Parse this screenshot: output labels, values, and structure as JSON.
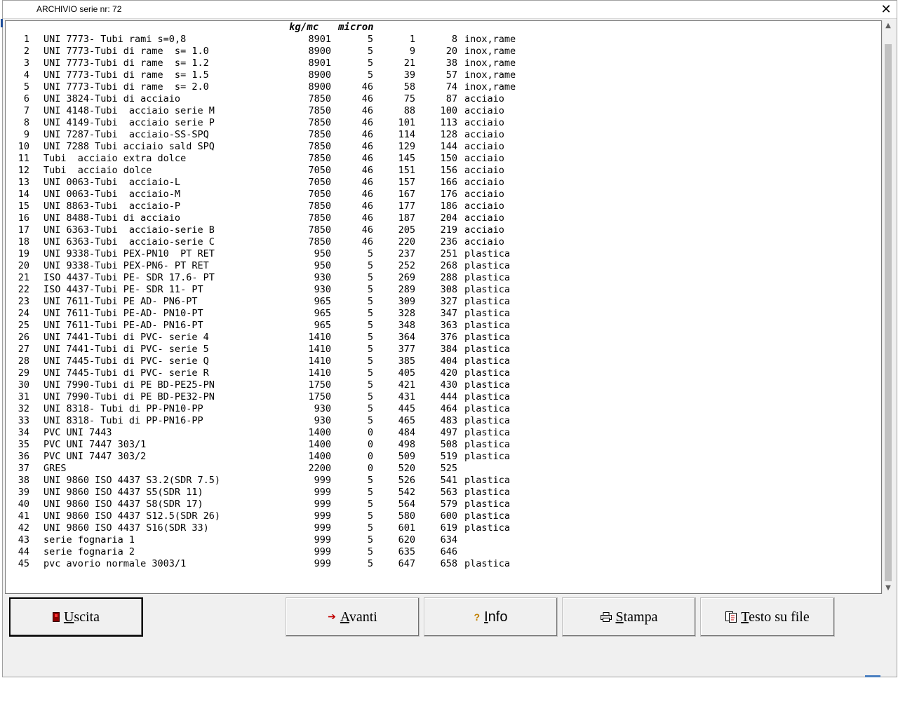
{
  "window": {
    "title": "ARCHIVIO serie nr: 72",
    "close_label": "✕"
  },
  "header": {
    "density_unit": "kg/mc",
    "thickness_unit": "micron"
  },
  "rows": [
    {
      "n": "1",
      "name": "UNI 7773- Tubi rami s=0,8",
      "dens": "8901",
      "mic": "5",
      "from": "1",
      "to": "8",
      "mat": "inox,rame"
    },
    {
      "n": "2",
      "name": "UNI 7773-Tubi di rame  s= 1.0",
      "dens": "8900",
      "mic": "5",
      "from": "9",
      "to": "20",
      "mat": "inox,rame"
    },
    {
      "n": "3",
      "name": "UNI 7773-Tubi di rame  s= 1.2",
      "dens": "8901",
      "mic": "5",
      "from": "21",
      "to": "38",
      "mat": "inox,rame"
    },
    {
      "n": "4",
      "name": "UNI 7773-Tubi di rame  s= 1.5",
      "dens": "8900",
      "mic": "5",
      "from": "39",
      "to": "57",
      "mat": "inox,rame"
    },
    {
      "n": "5",
      "name": "UNI 7773-Tubi di rame  s= 2.0",
      "dens": "8900",
      "mic": "46",
      "from": "58",
      "to": "74",
      "mat": "inox,rame"
    },
    {
      "n": "6",
      "name": "UNI 3824-Tubi di acciaio",
      "dens": "7850",
      "mic": "46",
      "from": "75",
      "to": "87",
      "mat": "acciaio"
    },
    {
      "n": "7",
      "name": "UNI 4148-Tubi  acciaio serie M",
      "dens": "7850",
      "mic": "46",
      "from": "88",
      "to": "100",
      "mat": "acciaio"
    },
    {
      "n": "8",
      "name": "UNI 4149-Tubi  acciaio serie P",
      "dens": "7850",
      "mic": "46",
      "from": "101",
      "to": "113",
      "mat": "acciaio"
    },
    {
      "n": "9",
      "name": "UNI 7287-Tubi  acciaio-SS-SPQ",
      "dens": "7850",
      "mic": "46",
      "from": "114",
      "to": "128",
      "mat": "acciaio"
    },
    {
      "n": "10",
      "name": "UNI 7288 Tubi acciaio sald SPQ",
      "dens": "7850",
      "mic": "46",
      "from": "129",
      "to": "144",
      "mat": "acciaio"
    },
    {
      "n": "11",
      "name": "Tubi  acciaio extra dolce",
      "dens": "7850",
      "mic": "46",
      "from": "145",
      "to": "150",
      "mat": "acciaio"
    },
    {
      "n": "12",
      "name": "Tubi  acciaio dolce",
      "dens": "7050",
      "mic": "46",
      "from": "151",
      "to": "156",
      "mat": "acciaio"
    },
    {
      "n": "13",
      "name": "UNI 0063-Tubi  acciaio-L",
      "dens": "7050",
      "mic": "46",
      "from": "157",
      "to": "166",
      "mat": "acciaio"
    },
    {
      "n": "14",
      "name": "UNI 0063-Tubi  acciaio-M",
      "dens": "7050",
      "mic": "46",
      "from": "167",
      "to": "176",
      "mat": "acciaio"
    },
    {
      "n": "15",
      "name": "UNI 8863-Tubi  acciaio-P",
      "dens": "7850",
      "mic": "46",
      "from": "177",
      "to": "186",
      "mat": "acciaio"
    },
    {
      "n": "16",
      "name": "UNI 8488-Tubi di acciaio",
      "dens": "7850",
      "mic": "46",
      "from": "187",
      "to": "204",
      "mat": "acciaio"
    },
    {
      "n": "17",
      "name": "UNI 6363-Tubi  acciaio-serie B",
      "dens": "7850",
      "mic": "46",
      "from": "205",
      "to": "219",
      "mat": "acciaio"
    },
    {
      "n": "18",
      "name": "UNI 6363-Tubi  acciaio-serie C",
      "dens": "7850",
      "mic": "46",
      "from": "220",
      "to": "236",
      "mat": "acciaio"
    },
    {
      "n": "19",
      "name": "UNI 9338-Tubi PEX-PN10  PT RET",
      "dens": "950",
      "mic": "5",
      "from": "237",
      "to": "251",
      "mat": "plastica"
    },
    {
      "n": "20",
      "name": "UNI 9338-Tubi PEX-PN6- PT RET",
      "dens": "950",
      "mic": "5",
      "from": "252",
      "to": "268",
      "mat": "plastica"
    },
    {
      "n": "21",
      "name": "ISO 4437-Tubi PE- SDR 17.6- PT",
      "dens": "930",
      "mic": "5",
      "from": "269",
      "to": "288",
      "mat": "plastica"
    },
    {
      "n": "22",
      "name": "ISO 4437-Tubi PE- SDR 11- PT",
      "dens": "930",
      "mic": "5",
      "from": "289",
      "to": "308",
      "mat": "plastica"
    },
    {
      "n": "23",
      "name": "UNI 7611-Tubi PE AD- PN6-PT",
      "dens": "965",
      "mic": "5",
      "from": "309",
      "to": "327",
      "mat": "plastica"
    },
    {
      "n": "24",
      "name": "UNI 7611-Tubi PE-AD- PN10-PT",
      "dens": "965",
      "mic": "5",
      "from": "328",
      "to": "347",
      "mat": "plastica"
    },
    {
      "n": "25",
      "name": "UNI 7611-Tubi PE-AD- PN16-PT",
      "dens": "965",
      "mic": "5",
      "from": "348",
      "to": "363",
      "mat": "plastica"
    },
    {
      "n": "26",
      "name": "UNI 7441-Tubi di PVC- serie 4",
      "dens": "1410",
      "mic": "5",
      "from": "364",
      "to": "376",
      "mat": "plastica"
    },
    {
      "n": "27",
      "name": "UNI 7441-Tubi di PVC- serie 5",
      "dens": "1410",
      "mic": "5",
      "from": "377",
      "to": "384",
      "mat": "plastica"
    },
    {
      "n": "28",
      "name": "UNI 7445-Tubi di PVC- serie Q",
      "dens": "1410",
      "mic": "5",
      "from": "385",
      "to": "404",
      "mat": "plastica"
    },
    {
      "n": "29",
      "name": "UNI 7445-Tubi di PVC- serie R",
      "dens": "1410",
      "mic": "5",
      "from": "405",
      "to": "420",
      "mat": "plastica"
    },
    {
      "n": "30",
      "name": "UNI 7990-Tubi di PE BD-PE25-PN",
      "dens": "1750",
      "mic": "5",
      "from": "421",
      "to": "430",
      "mat": "plastica"
    },
    {
      "n": "31",
      "name": "UNI 7990-Tubi di PE BD-PE32-PN",
      "dens": "1750",
      "mic": "5",
      "from": "431",
      "to": "444",
      "mat": "plastica"
    },
    {
      "n": "32",
      "name": "UNI 8318- Tubi di PP-PN10-PP",
      "dens": "930",
      "mic": "5",
      "from": "445",
      "to": "464",
      "mat": "plastica"
    },
    {
      "n": "33",
      "name": "UNI 8318- Tubi di PP-PN16-PP",
      "dens": "930",
      "mic": "5",
      "from": "465",
      "to": "483",
      "mat": "plastica"
    },
    {
      "n": "34",
      "name": "PVC UNI 7443",
      "dens": "1400",
      "mic": "0",
      "from": "484",
      "to": "497",
      "mat": "plastica"
    },
    {
      "n": "35",
      "name": "PVC UNI 7447 303/1",
      "dens": "1400",
      "mic": "0",
      "from": "498",
      "to": "508",
      "mat": "plastica"
    },
    {
      "n": "36",
      "name": "PVC UNI 7447 303/2",
      "dens": "1400",
      "mic": "0",
      "from": "509",
      "to": "519",
      "mat": "plastica"
    },
    {
      "n": "37",
      "name": "GRES",
      "dens": "2200",
      "mic": "0",
      "from": "520",
      "to": "525",
      "mat": ""
    },
    {
      "n": "38",
      "name": "UNI 9860 ISO 4437 S3.2(SDR 7.5)",
      "dens": "999",
      "mic": "5",
      "from": "526",
      "to": "541",
      "mat": "plastica"
    },
    {
      "n": "39",
      "name": "UNI 9860 ISO 4437 S5(SDR 11)",
      "dens": "999",
      "mic": "5",
      "from": "542",
      "to": "563",
      "mat": "plastica"
    },
    {
      "n": "40",
      "name": "UNI 9860 ISO 4437 S8(SDR 17)",
      "dens": "999",
      "mic": "5",
      "from": "564",
      "to": "579",
      "mat": "plastica"
    },
    {
      "n": "41",
      "name": "UNI 9860 ISO 4437 S12.5(SDR 26)",
      "dens": "999",
      "mic": "5",
      "from": "580",
      "to": "600",
      "mat": "plastica"
    },
    {
      "n": "42",
      "name": "UNI 9860 ISO 4437 S16(SDR 33)",
      "dens": "999",
      "mic": "5",
      "from": "601",
      "to": "619",
      "mat": "plastica"
    },
    {
      "n": "43",
      "name": "serie fognaria 1",
      "dens": "999",
      "mic": "5",
      "from": "620",
      "to": "634",
      "mat": ""
    },
    {
      "n": "44",
      "name": "serie fognaria 2",
      "dens": "999",
      "mic": "5",
      "from": "635",
      "to": "646",
      "mat": ""
    },
    {
      "n": "45",
      "name": "pvc avorio normale 3003/1",
      "dens": "999",
      "mic": "5",
      "from": "647",
      "to": "658",
      "mat": "plastica"
    }
  ],
  "buttons": {
    "uscita": {
      "ul": "U",
      "rest": "scita",
      "icon": "exit-door-icon"
    },
    "avanti": {
      "ul": "A",
      "rest": "vanti",
      "icon": "arrow-right-icon"
    },
    "info": {
      "ul": "I",
      "rest": "nfo",
      "icon": "question-icon"
    },
    "stampa": {
      "ul": "S",
      "rest": "tampa",
      "icon": "printer-icon"
    },
    "testo": {
      "ul": "T",
      "rest": "esto su file",
      "icon": "file-icon"
    }
  },
  "colors": {
    "accent": "#1f4e9a",
    "exit_icon": "#8b0000",
    "arrow_icon": "#c00000",
    "question_icon": "#c08000"
  }
}
